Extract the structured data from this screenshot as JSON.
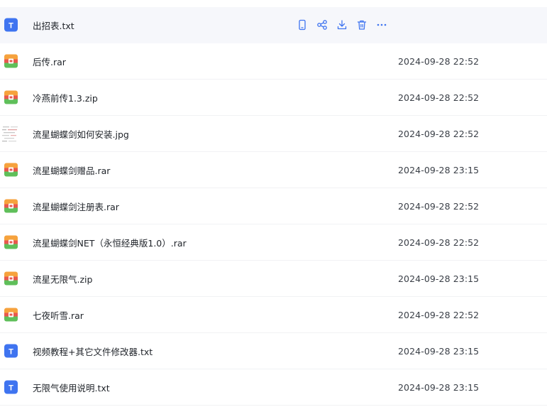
{
  "colors": {
    "accent": "#3f74f0",
    "hover_row": "#f6f7fb",
    "text": "#1f2329"
  },
  "hovered_row_actions": [
    {
      "name": "mobile-icon"
    },
    {
      "name": "share-icon"
    },
    {
      "name": "download-icon"
    },
    {
      "name": "delete-icon"
    },
    {
      "name": "more-icon"
    }
  ],
  "files": [
    {
      "name": "出招表.txt",
      "type": "txt",
      "time": "",
      "icon": "txt-file-icon"
    },
    {
      "name": "后传.rar",
      "type": "archive",
      "time": "2024-09-28 22:52",
      "icon": "archive-file-icon"
    },
    {
      "name": "冷燕前传1.3.zip",
      "type": "archive",
      "time": "2024-09-28 22:52",
      "icon": "archive-file-icon"
    },
    {
      "name": "流星蝴蝶剑如何安装.jpg",
      "type": "image",
      "time": "2024-09-28 22:52",
      "icon": "image-thumbnail-icon"
    },
    {
      "name": "流星蝴蝶剑赠品.rar",
      "type": "archive",
      "time": "2024-09-28 23:15",
      "icon": "archive-file-icon"
    },
    {
      "name": "流星蝴蝶剑注册表.rar",
      "type": "archive",
      "time": "2024-09-28 22:52",
      "icon": "archive-file-icon"
    },
    {
      "name": "流星蝴蝶剑NET（永恒经典版1.0）.rar",
      "type": "archive",
      "time": "2024-09-28 22:52",
      "icon": "archive-file-icon"
    },
    {
      "name": "流星无限气.zip",
      "type": "archive",
      "time": "2024-09-28 23:15",
      "icon": "archive-file-icon"
    },
    {
      "name": "七夜听雪.rar",
      "type": "archive",
      "time": "2024-09-28 22:52",
      "icon": "archive-file-icon"
    },
    {
      "name": "视频教程+其它文件修改器.txt",
      "type": "txt",
      "time": "2024-09-28 23:15",
      "icon": "txt-file-icon"
    },
    {
      "name": "无限气使用说明.txt",
      "type": "txt",
      "time": "2024-09-28 23:15",
      "icon": "txt-file-icon"
    }
  ]
}
